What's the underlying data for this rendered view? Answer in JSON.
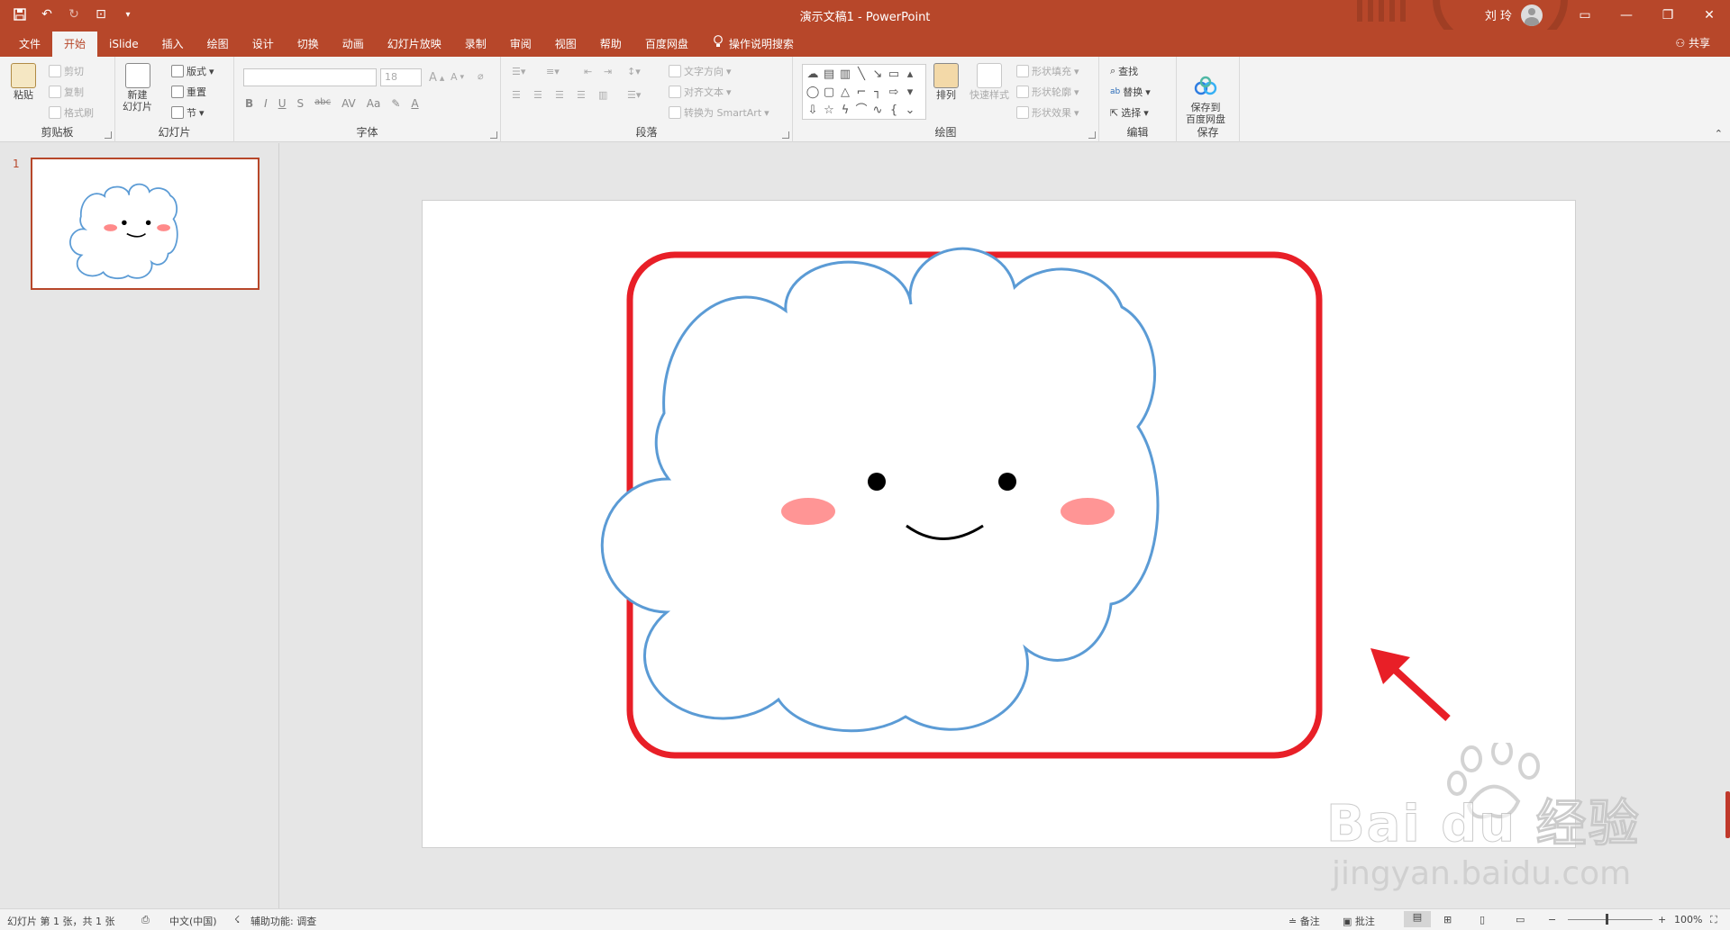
{
  "window": {
    "title": "演示文稿1  -  PowerPoint",
    "user": "刘 玲",
    "share": "共享"
  },
  "tabs": [
    "文件",
    "开始",
    "iSlide",
    "插入",
    "绘图",
    "设计",
    "切换",
    "动画",
    "幻灯片放映",
    "录制",
    "审阅",
    "视图",
    "帮助",
    "百度网盘"
  ],
  "tell_me": "操作说明搜索",
  "ribbon": {
    "clipboard": {
      "label": "剪贴板",
      "paste": "粘贴",
      "cut": "剪切",
      "copy": "复制",
      "painter": "格式刷"
    },
    "slides": {
      "label": "幻灯片",
      "new_slide": "新建\n幻灯片",
      "layout": "版式",
      "reset": "重置",
      "section": "节"
    },
    "font": {
      "label": "字体",
      "size": "18"
    },
    "paragraph": {
      "label": "段落",
      "text_direction": "文字方向",
      "align_text": "对齐文本",
      "smartart": "转换为 SmartArt"
    },
    "drawing": {
      "label": "绘图",
      "arrange": "排列",
      "quick_styles": "快速样式",
      "fill": "形状填充",
      "outline": "形状轮廓",
      "effects": "形状效果"
    },
    "editing": {
      "label": "编辑",
      "find": "查找",
      "replace": "替换",
      "select": "选择"
    },
    "save": {
      "label": "保存",
      "save_to": "保存到\n百度网盘"
    }
  },
  "thumbnail": {
    "number": "1"
  },
  "status": {
    "slide_info": "幻灯片 第 1 张，共 1 张",
    "language": "中文(中国)",
    "accessibility": "辅助功能: 调查",
    "notes": "备注",
    "comments": "批注",
    "zoom": "100%"
  },
  "watermark": {
    "brand": "Bai du 经验",
    "url": "jingyan.baidu.com"
  },
  "colors": {
    "accent": "#b7472a",
    "cloud_stroke": "#5b9bd5",
    "highlight": "#e81f27",
    "blush": "#ff8a8a"
  }
}
